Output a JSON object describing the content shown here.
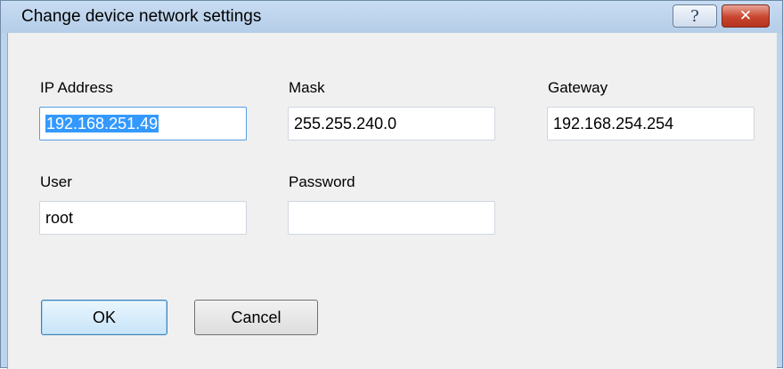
{
  "window": {
    "title": "Change device network settings",
    "help_glyph": "?",
    "close_glyph": "✕"
  },
  "fields": {
    "ip": {
      "label": "IP Address",
      "value": "192.168.251.49"
    },
    "mask": {
      "label": "Mask",
      "value": "255.255.240.0"
    },
    "gateway": {
      "label": "Gateway",
      "value": "192.168.254.254"
    },
    "user": {
      "label": "User",
      "value": "root"
    },
    "password": {
      "label": "Password",
      "value": ""
    }
  },
  "buttons": {
    "ok": "OK",
    "cancel": "Cancel"
  },
  "icons": {
    "help": "help-icon",
    "close": "close-icon"
  },
  "colors": {
    "titlebar": "#bcd3ec",
    "close_button": "#c8452e",
    "selection": "#3399ff",
    "focus_border": "#569de5",
    "default_button": "#c7e4f8"
  }
}
